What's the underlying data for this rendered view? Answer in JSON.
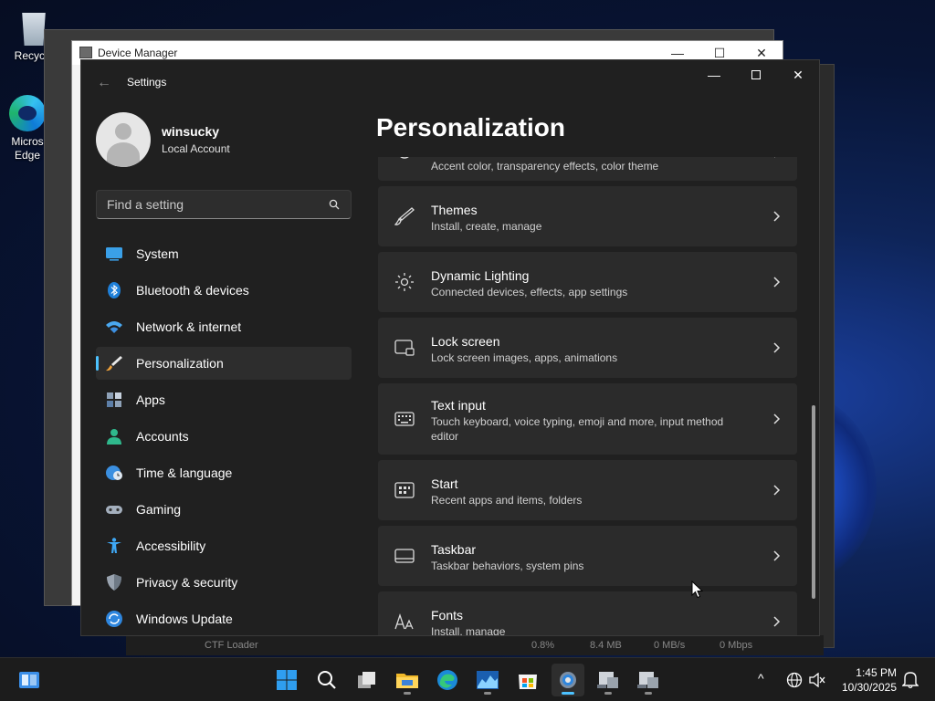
{
  "desktop": {
    "icons": [
      {
        "label": "Recycle",
        "icon": "recycle-bin-icon"
      },
      {
        "label": "Micros Edge",
        "icon": "edge-icon"
      }
    ]
  },
  "device_manager": {
    "title": "Device Manager",
    "minimize": "—",
    "maximize": "☐",
    "close": "✕"
  },
  "background_process": {
    "name": "CTF Loader",
    "cpu": "0.8%",
    "memory": "8.4 MB",
    "disk": "0 MB/s",
    "network": "0 Mbps"
  },
  "settings": {
    "app_title": "Settings",
    "back_glyph": "←",
    "minimize": "—",
    "close": "✕",
    "profile": {
      "name": "winsucky",
      "account_type": "Local Account"
    },
    "search": {
      "placeholder": "Find a setting"
    },
    "nav": [
      {
        "label": "System",
        "icon": "system-monitor-icon"
      },
      {
        "label": "Bluetooth & devices",
        "icon": "bluetooth-icon"
      },
      {
        "label": "Network & internet",
        "icon": "wifi-icon"
      },
      {
        "label": "Personalization",
        "icon": "paintbrush-icon",
        "active": true
      },
      {
        "label": "Apps",
        "icon": "apps-icon"
      },
      {
        "label": "Accounts",
        "icon": "accounts-icon"
      },
      {
        "label": "Time & language",
        "icon": "globe-clock-icon"
      },
      {
        "label": "Gaming",
        "icon": "gamepad-icon"
      },
      {
        "label": "Accessibility",
        "icon": "accessibility-icon"
      },
      {
        "label": "Privacy & security",
        "icon": "shield-icon"
      },
      {
        "label": "Windows Update",
        "icon": "update-icon"
      }
    ],
    "page_title": "Personalization",
    "cards": [
      {
        "title": "",
        "subtitle": "Accent color, transparency effects, color theme",
        "icon": "colors-icon"
      },
      {
        "title": "Themes",
        "subtitle": "Install, create, manage",
        "icon": "brush-icon"
      },
      {
        "title": "Dynamic Lighting",
        "subtitle": "Connected devices, effects, app settings",
        "icon": "lighting-icon"
      },
      {
        "title": "Lock screen",
        "subtitle": "Lock screen images, apps, animations",
        "icon": "lock-screen-icon"
      },
      {
        "title": "Text input",
        "subtitle": "Touch keyboard, voice typing, emoji and more, input method editor",
        "icon": "keyboard-icon"
      },
      {
        "title": "Start",
        "subtitle": "Recent apps and items, folders",
        "icon": "start-icon"
      },
      {
        "title": "Taskbar",
        "subtitle": "Taskbar behaviors, system pins",
        "icon": "taskbar-icon"
      },
      {
        "title": "Fonts",
        "subtitle": "Install, manage",
        "icon": "fonts-icon"
      }
    ]
  },
  "taskbar": {
    "time": "1:45 PM",
    "date": "10/30/2025",
    "overflow_glyph": "^"
  }
}
